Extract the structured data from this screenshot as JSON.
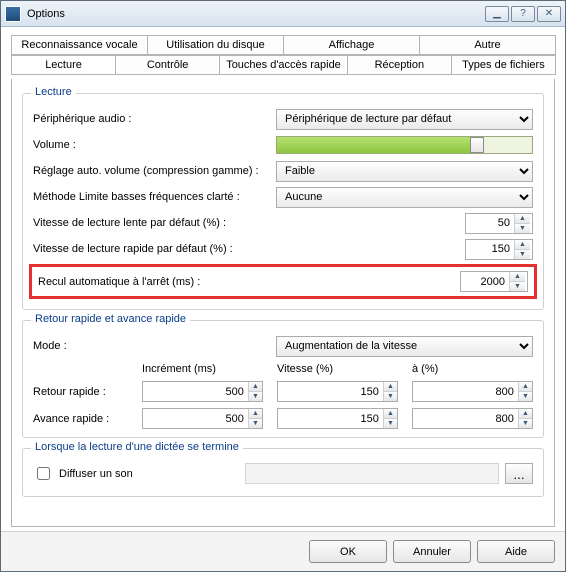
{
  "window": {
    "title": "Options"
  },
  "tabs_top": [
    "Reconnaissance vocale",
    "Utilisation du disque",
    "Affichage",
    "Autre"
  ],
  "tabs_bottom": [
    "Lecture",
    "Contrôle",
    "Touches d'accès rapide",
    "Réception",
    "Types de fichiers"
  ],
  "active_tab": "Lecture",
  "lecture": {
    "legend": "Lecture",
    "audio_label": "Périphérique audio :",
    "audio_value": "Périphérique de lecture par défaut",
    "volume_label": "Volume :",
    "volume_percent": 76,
    "autovol_label": "Réglage auto. volume (compression gamme) :",
    "autovol_value": "Faible",
    "bass_label": "Méthode Limite basses fréquences clarté :",
    "bass_value": "Aucune",
    "slow_label": "Vitesse de lecture lente par défaut (%) :",
    "slow_value": "50",
    "fast_label": "Vitesse de lecture rapide par défaut (%) :",
    "fast_value": "150",
    "rewind_label": "Recul automatique à l'arrêt (ms) :",
    "rewind_value": "2000"
  },
  "ffrw": {
    "legend": "Retour rapide et avance rapide",
    "mode_label": "Mode :",
    "mode_value": "Augmentation de la vitesse",
    "col_increment": "Incrément (ms)",
    "col_speed": "Vitesse (%)",
    "col_to": "à (%)",
    "rw_label": "Retour rapide :",
    "ff_label": "Avance rapide :",
    "rw": {
      "increment": "500",
      "speed": "150",
      "to": "800"
    },
    "ff": {
      "increment": "500",
      "speed": "150",
      "to": "800"
    }
  },
  "end": {
    "legend": "Lorsque la lecture d'une dictée se termine",
    "play_sound_label": "Diffuser un son",
    "sound_path": "",
    "browse_label": "..."
  },
  "buttons": {
    "ok": "OK",
    "cancel": "Annuler",
    "help": "Aide"
  }
}
